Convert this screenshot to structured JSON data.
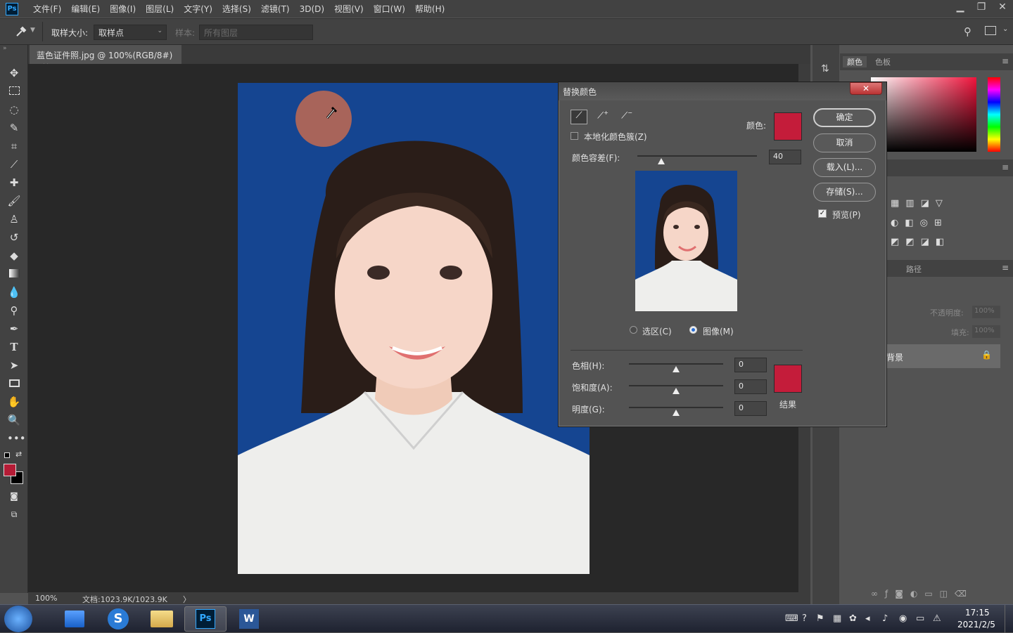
{
  "menubar": {
    "app_icon": "Ps",
    "items": [
      "文件(F)",
      "编辑(E)",
      "图像(I)",
      "图层(L)",
      "文字(Y)",
      "选择(S)",
      "滤镜(T)",
      "3D(D)",
      "视图(V)",
      "窗口(W)",
      "帮助(H)"
    ],
    "window_controls": {
      "minimize": "▁",
      "restore": "❐",
      "close": "✕"
    }
  },
  "options": {
    "sample_size_label": "取样大小:",
    "sample_size_value": "取样点",
    "sample_label": "样本:",
    "sample_value": "所有图层"
  },
  "document": {
    "tab_title": "蓝色证件照.jpg @ 100%(RGB/8#)",
    "tab_close": "×",
    "zoom": "100%",
    "doc_info": "文档:1023.9K/1023.9K",
    "status_arrow": "〉"
  },
  "colors": {
    "foreground": "#b51c36",
    "background": "#000000",
    "photo_bg": "#154591",
    "replace_color": "#c41c3a",
    "result_color": "#c41c3a",
    "sampled_spot": "#a8645a"
  },
  "right_panel": {
    "tab_color": "颜色",
    "tab_swatches": "色板",
    "tab_paths": "路径",
    "opacity_label": "不透明度:",
    "opacity_value": "100%",
    "fill_label": "填充:",
    "fill_value": "100%",
    "layer_name": "背景"
  },
  "dialog": {
    "title": "替换颜色",
    "close": "✕",
    "localized_label": "本地化颜色簇(Z)",
    "color_label": "颜色:",
    "fuzziness_label": "颜色容差(F):",
    "fuzziness_value": "40",
    "fuzziness_fraction": 0.2,
    "radio_selection": "选区(C)",
    "radio_image": "图像(M)",
    "hue_label": "色相(H):",
    "hue_value": "0",
    "saturation_label": "饱和度(A):",
    "saturation_value": "0",
    "lightness_label": "明度(G):",
    "lightness_value": "0",
    "result_label": "结果",
    "ok": "确定",
    "cancel": "取消",
    "load": "载入(L)...",
    "save": "存储(S)...",
    "preview": "预览(P)"
  },
  "taskbar": {
    "time": "17:15",
    "date": "2021/2/5"
  }
}
